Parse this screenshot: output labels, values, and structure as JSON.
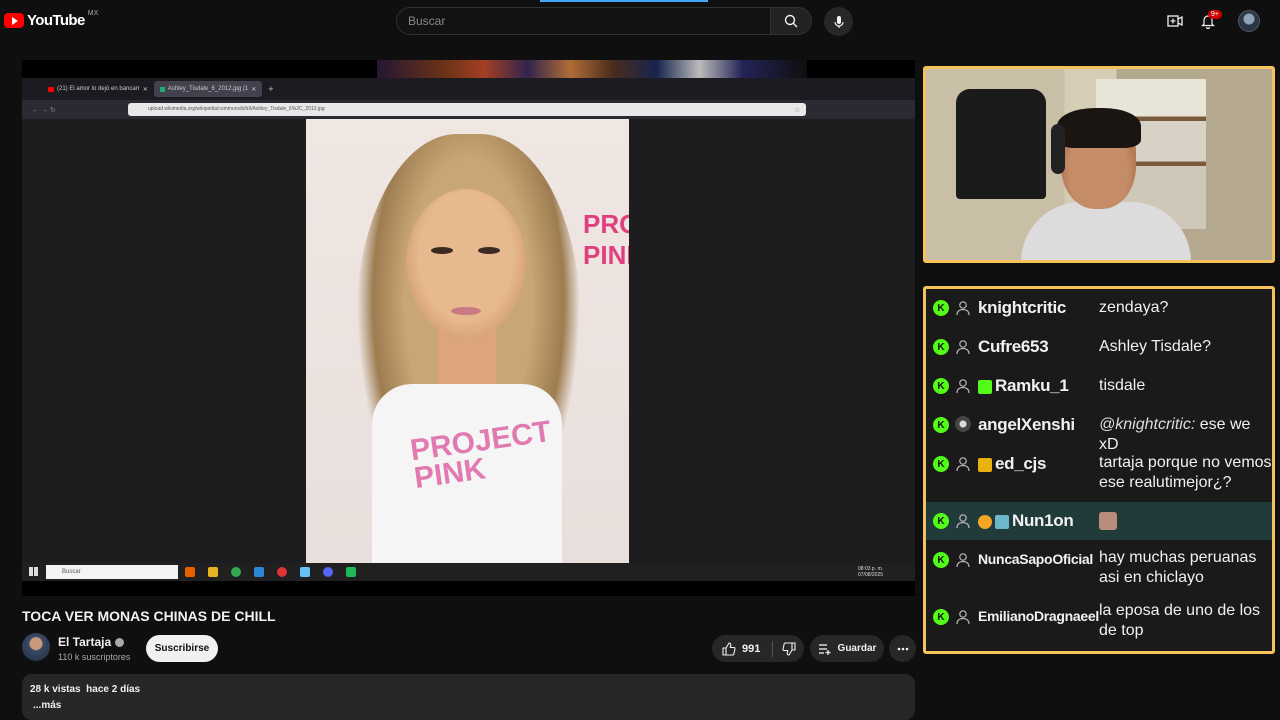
{
  "header": {
    "logo_text": "YouTube",
    "region": "MX",
    "search_placeholder": "Buscar",
    "notification_count": "9+"
  },
  "player": {
    "browser_tabs": [
      {
        "label": "(21) El amor lo dejó en bancarr"
      },
      {
        "label": "Ashley_Tisdale_6_2012.jpg (1"
      }
    ],
    "address": "upload.wikimedia.org/wikipedia/commons/b/b9/Ashley_Tisdale_6%2C_2012.jpg",
    "photo_text": "PROJECT PINK",
    "photo_mark": "PROJECT PINK",
    "taskbar_search": "Buscar",
    "taskbar_time": "08:03 p. m.",
    "taskbar_date": "07/08/2025"
  },
  "video": {
    "title": "TOCA VER MONAS CHINAS DE CHILL",
    "channel": "El Tartaja",
    "subscribers": "110 k suscriptores",
    "subscribe_label": "Suscribirse",
    "likes": "991",
    "save_label": "Guardar",
    "views": "28 k vistas",
    "age": "hace 2 días",
    "more_label": "...más"
  },
  "chat": {
    "messages": [
      {
        "user": "knightcritic",
        "text": "zendaya?"
      },
      {
        "user": "Cufre653",
        "text": "Ashley Tisdale?"
      },
      {
        "user": "Ramku_1",
        "text": "tisdale"
      },
      {
        "user": "angelXenshi",
        "mention": "@knightcritic:",
        "text": "ese we xD"
      },
      {
        "user": "ed_cjs",
        "text": "tartaja porque no vemos ese realutimejor¿?"
      },
      {
        "user": "Nun1on",
        "text": ""
      },
      {
        "user": "NuncaSapoOficial",
        "text": "hay muchas peruanas asi en chiclayo"
      },
      {
        "user": "EmilianoDragnaeel",
        "text": "la eposa de uno de los de top"
      }
    ]
  },
  "colors": {
    "accent_border": "#f5c25a",
    "kick_green": "#53fc18",
    "youtube_red": "#ff0000"
  },
  "icons": [
    "youtube-logo-icon",
    "search-icon",
    "mic-icon",
    "create-icon",
    "bell-icon",
    "like-icon",
    "dislike-icon",
    "save-icon",
    "more-icon",
    "verified-icon",
    "kick-icon",
    "user-icon"
  ]
}
